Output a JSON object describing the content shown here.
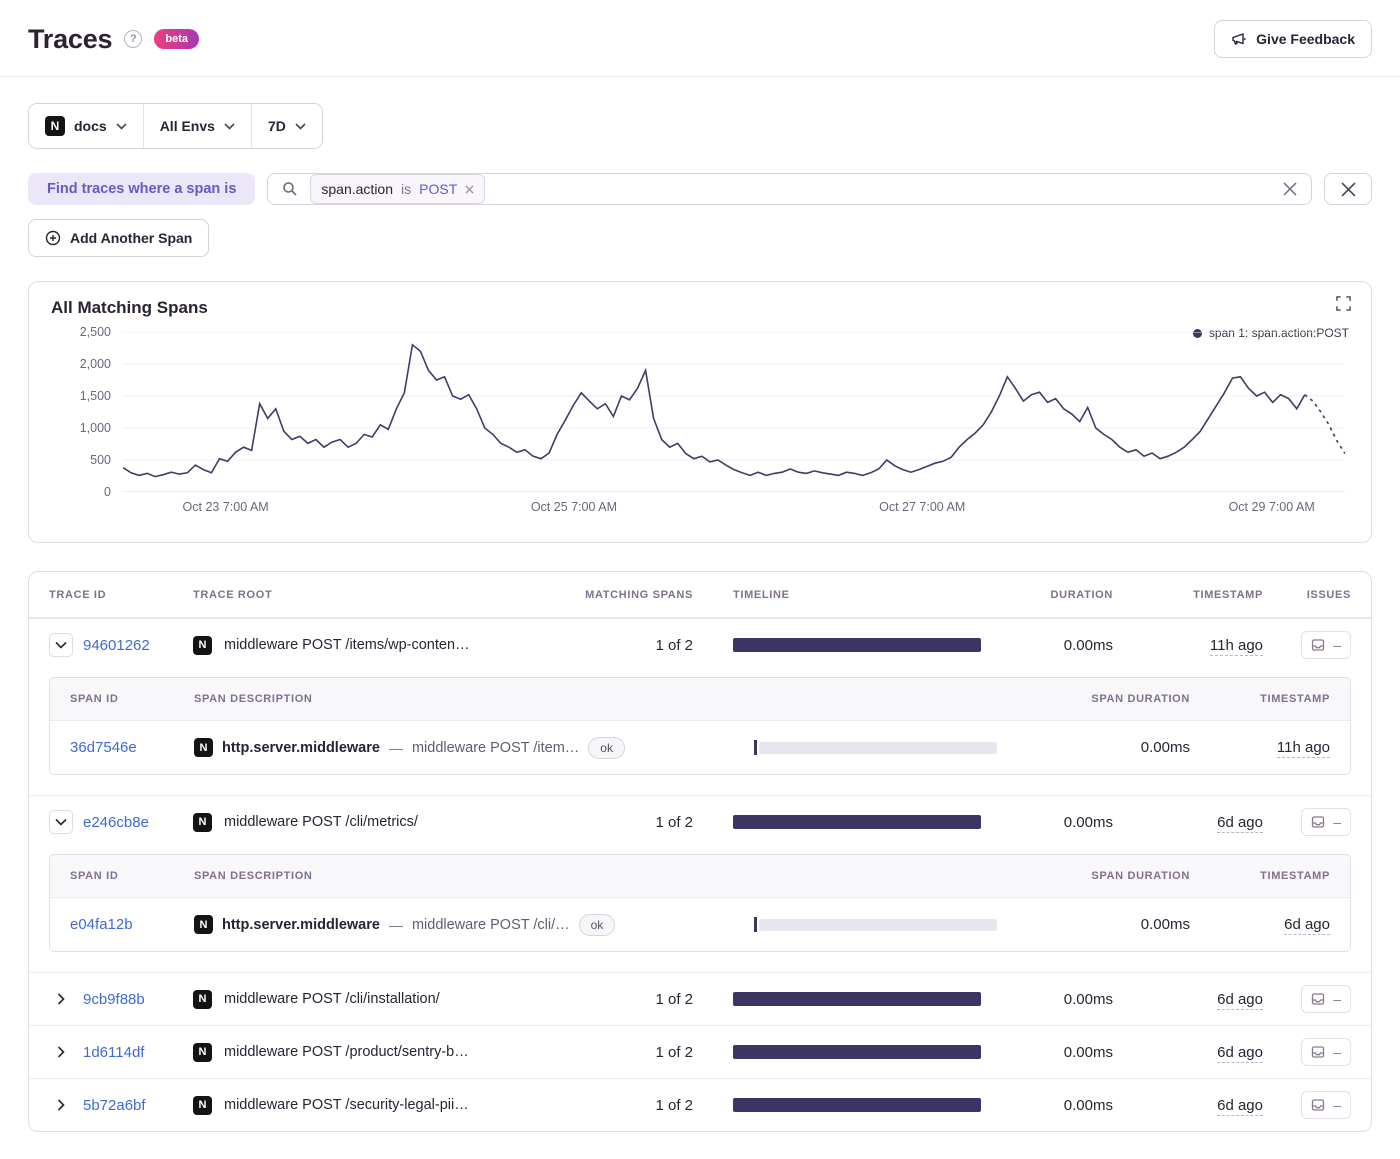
{
  "colors": {
    "accent": "#6A58C6",
    "bar": "#3B3563",
    "line": "#433A68",
    "link": "#3F6AD1",
    "badge_gradient": [
      "#ED3E7E",
      "#A737B4"
    ]
  },
  "icons": {
    "project_letter": "N",
    "help_glyph": "?"
  },
  "header": {
    "title": "Traces",
    "badge": "beta",
    "feedback_label": "Give Feedback"
  },
  "filters": {
    "project": "docs",
    "env": "All Envs",
    "period": "7D"
  },
  "search": {
    "label": "Find traces where a span is",
    "token": {
      "key": "span.action",
      "op": "is",
      "value": "POST"
    },
    "add_span_label": "Add Another Span"
  },
  "chart_data": {
    "type": "line",
    "title": "All Matching Spans",
    "legend": "span 1: span.action:POST",
    "ylim": [
      0,
      2500
    ],
    "y_ticks": [
      "2,500",
      "2,000",
      "1,500",
      "1,000",
      "500",
      "0"
    ],
    "x_ticks": [
      "Oct 23 7:00 AM",
      "Oct 25 7:00 AM",
      "Oct 27 7:00 AM",
      "Oct 29 7:00 AM"
    ],
    "grid": true,
    "legend_position": "top-right",
    "values": [
      380,
      300,
      260,
      290,
      240,
      270,
      310,
      280,
      300,
      420,
      350,
      300,
      520,
      480,
      620,
      700,
      650,
      1380,
      1150,
      1300,
      950,
      820,
      870,
      760,
      820,
      700,
      780,
      820,
      700,
      760,
      900,
      860,
      1050,
      980,
      1300,
      1550,
      2300,
      2200,
      1900,
      1750,
      1800,
      1500,
      1450,
      1520,
      1300,
      1000,
      900,
      760,
      700,
      620,
      660,
      560,
      520,
      610,
      900,
      1120,
      1350,
      1550,
      1420,
      1300,
      1380,
      1180,
      1500,
      1440,
      1620,
      1900,
      1150,
      820,
      700,
      760,
      600,
      520,
      560,
      470,
      500,
      420,
      350,
      300,
      260,
      310,
      260,
      290,
      310,
      360,
      310,
      290,
      330,
      300,
      280,
      260,
      310,
      290,
      260,
      300,
      360,
      500,
      410,
      350,
      310,
      350,
      400,
      450,
      480,
      540,
      700,
      820,
      920,
      1050,
      1250,
      1500,
      1800,
      1620,
      1420,
      1520,
      1560,
      1400,
      1460,
      1300,
      1220,
      1100,
      1320,
      1000,
      900,
      820,
      700,
      620,
      660,
      560,
      610,
      520,
      560,
      620,
      700,
      820,
      950,
      1150,
      1350,
      1550,
      1780,
      1800,
      1620,
      1500,
      1560,
      1400,
      1520,
      1460,
      1300,
      1520,
      1420,
      1250,
      1050,
      800,
      600
    ]
  },
  "table": {
    "sep": "—",
    "issues_empty": "–",
    "headers": {
      "trace_id": "TRACE ID",
      "trace_root": "TRACE ROOT",
      "matching": "MATCHING SPANS",
      "timeline": "TIMELINE",
      "duration": "DURATION",
      "timestamp": "TIMESTAMP",
      "issues": "ISSUES"
    },
    "sub_headers": {
      "span_id": "SPAN ID",
      "desc": "SPAN DESCRIPTION",
      "duration": "SPAN DURATION",
      "timestamp": "TIMESTAMP"
    },
    "rows": [
      {
        "id": "94601262",
        "root": "middleware POST /items/wp-conten…",
        "matching": "1 of 2",
        "duration": "0.00ms",
        "timestamp": "11h ago",
        "spans": [
          {
            "id": "36d7546e",
            "op": "http.server.middleware",
            "desc": "middleware POST /item…",
            "status": "ok",
            "duration": "0.00ms",
            "timestamp": "11h ago"
          }
        ]
      },
      {
        "id": "e246cb8e",
        "root": "middleware POST /cli/metrics/",
        "matching": "1 of 2",
        "duration": "0.00ms",
        "timestamp": "6d ago",
        "spans": [
          {
            "id": "e04fa12b",
            "op": "http.server.middleware",
            "desc": "middleware POST /cli/…",
            "status": "ok",
            "duration": "0.00ms",
            "timestamp": "6d ago"
          }
        ]
      },
      {
        "id": "9cb9f88b",
        "root": "middleware POST /cli/installation/",
        "matching": "1 of 2",
        "duration": "0.00ms",
        "timestamp": "6d ago"
      },
      {
        "id": "1d6114df",
        "root": "middleware POST /product/sentry-b…",
        "matching": "1 of 2",
        "duration": "0.00ms",
        "timestamp": "6d ago"
      },
      {
        "id": "5b72a6bf",
        "root": "middleware POST /security-legal-pii…",
        "matching": "1 of 2",
        "duration": "0.00ms",
        "timestamp": "6d ago"
      }
    ]
  }
}
